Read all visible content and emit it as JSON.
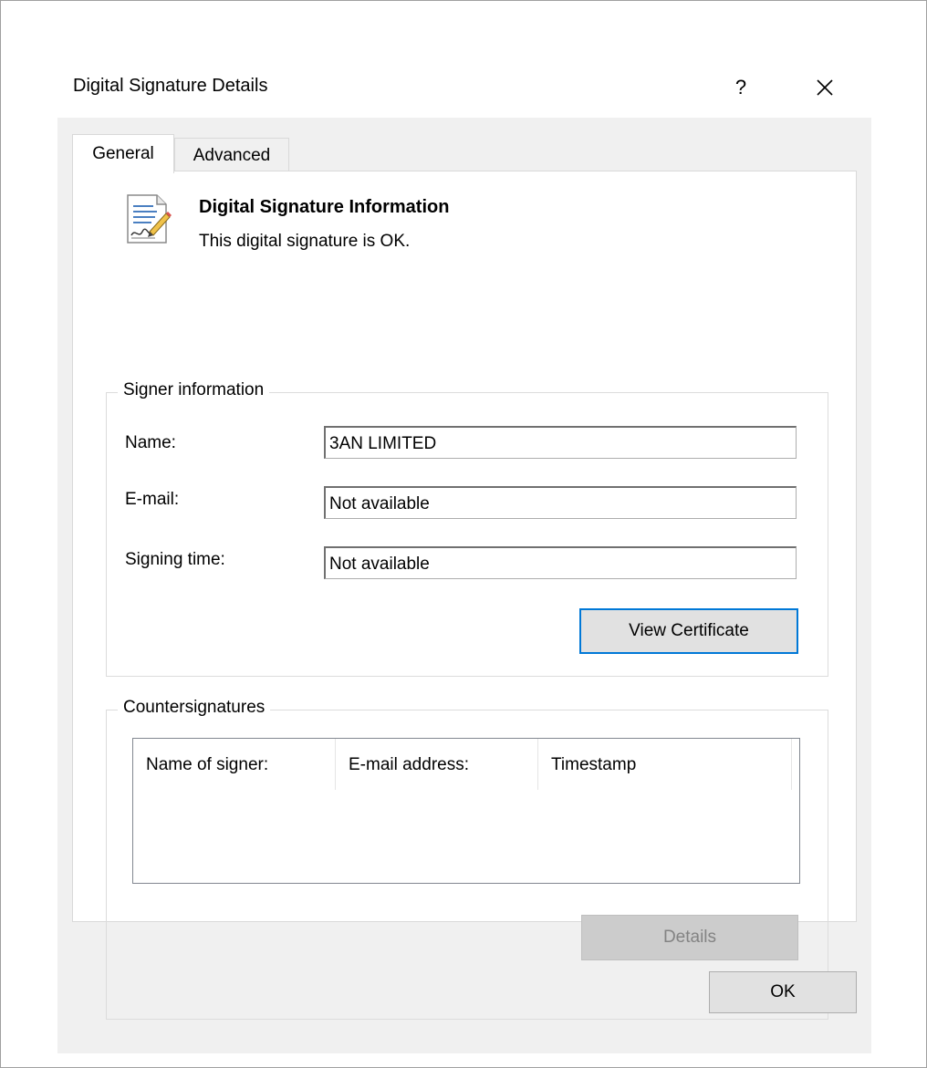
{
  "dialog": {
    "title": "Digital Signature Details",
    "help_glyph": "?",
    "close_glyph": "✕"
  },
  "tabs": [
    {
      "label": "General",
      "selected": true
    },
    {
      "label": "Advanced",
      "selected": false
    }
  ],
  "info": {
    "title": "Digital Signature Information",
    "status": "This digital signature is OK."
  },
  "signer": {
    "legend": "Signer information",
    "name_label": "Name:",
    "name_value": "3AN LIMITED",
    "email_label": "E-mail:",
    "email_value": "Not available",
    "time_label": "Signing time:",
    "time_value": "Not available",
    "view_certificate": "View Certificate"
  },
  "countersignatures": {
    "legend": "Countersignatures",
    "columns": [
      "Name of signer:",
      "E-mail address:",
      "Timestamp"
    ],
    "rows": [],
    "details": "Details"
  },
  "footer": {
    "ok": "OK"
  },
  "colors": {
    "focus_border": "#0078d7",
    "dialog_bg": "#f0f0f0",
    "disabled_text": "#838383"
  },
  "icons": [
    "signature-document-icon",
    "help-icon",
    "close-icon"
  ]
}
